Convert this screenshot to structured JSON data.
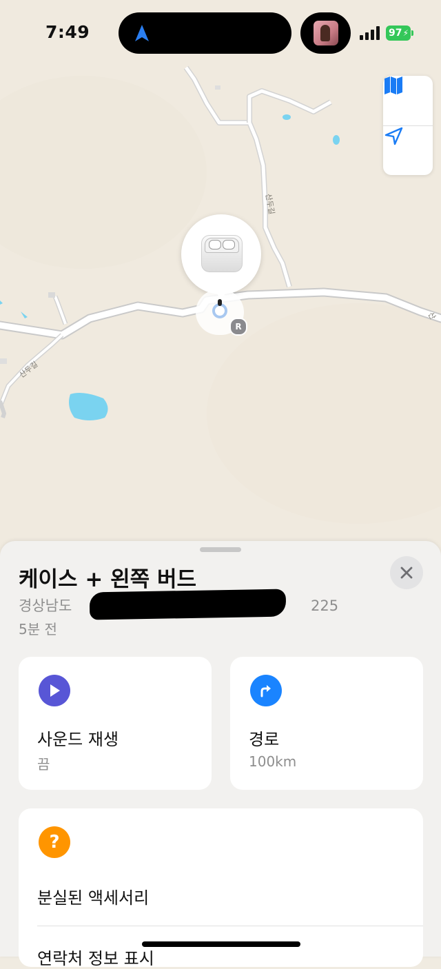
{
  "status_bar": {
    "time": "7:49",
    "battery": "97"
  },
  "map": {
    "road_labels": [
      "산두길",
      "산두길",
      "산"
    ]
  },
  "pin": {
    "badge": "R"
  },
  "sheet": {
    "title": "케이스 + 왼쪽 버드",
    "address_start": "경상남도 ",
    "address_end": "225",
    "time_ago": "5분 전",
    "cards": {
      "sound": {
        "label": "사운드 재생",
        "sub": "끔",
        "color": "#5856d6",
        "icon": "play-icon"
      },
      "directions": {
        "label": "경로",
        "sub": "100km",
        "color": "#1a84ff",
        "icon": "turn-right-arrow-icon"
      },
      "lost": {
        "label": "분실된 액세서리",
        "color": "#ff9500",
        "icon": "question-icon"
      },
      "contact": {
        "label": "연락처 정보 표시"
      }
    }
  },
  "colors": {
    "accent": "#007aff",
    "battery": "#34c759",
    "map_bg": "#f0eadf",
    "water": "#7ad3f0"
  }
}
